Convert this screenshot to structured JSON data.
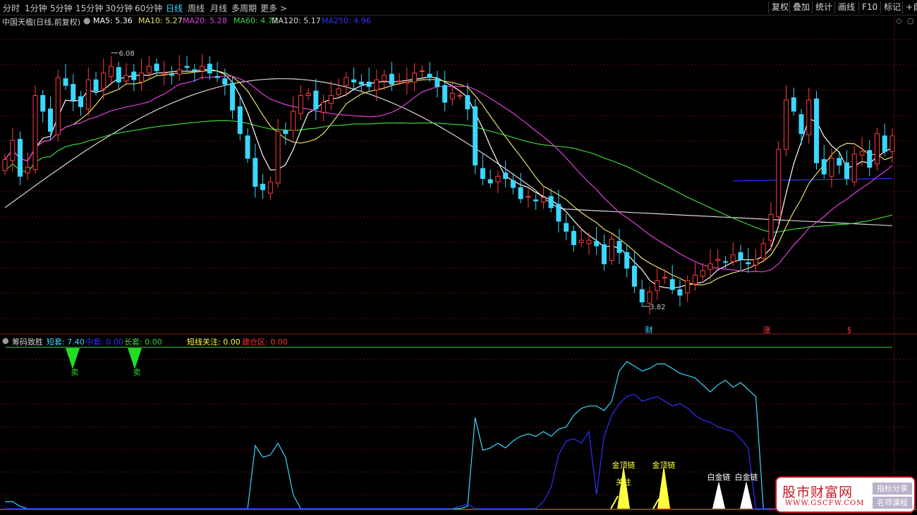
{
  "toolbar": {
    "tabs": [
      "分时",
      "1分钟",
      "5分钟",
      "15分钟",
      "30分钟",
      "60分钟",
      "日线",
      "周线",
      "月线",
      "多周期",
      "更多 >"
    ],
    "active_tab": "日线",
    "right_buttons": [
      "复权",
      "叠加",
      "统计",
      "画线",
      "F10",
      "标记",
      "+自"
    ]
  },
  "main_chart": {
    "title": "中国天楹(日线,前复权)",
    "ma": [
      {
        "label": "MA5: 5.36",
        "color": "#ffffff"
      },
      {
        "label": "MA10: 5.27",
        "color": "#e8e06a"
      },
      {
        "label": "MA20: 5.28",
        "color": "#e040e0"
      },
      {
        "label": "MA60: 4.72",
        "color": "#3fd23f"
      },
      {
        "label": "MA120: 5.17",
        "color": "#d8d8d8"
      },
      {
        "label": "MA250: 4.96",
        "color": "#3030ff"
      }
    ],
    "high_label": "6.08",
    "low_label": "3.82",
    "markers": [
      {
        "text": "财",
        "color": "#3ad7ff"
      },
      {
        "text": "涨",
        "color": "#ff4040"
      },
      {
        "text": "§",
        "color": "#ff4040"
      }
    ]
  },
  "indicator": {
    "name": "筹码致胜",
    "items": [
      {
        "label": "短套: ",
        "value": "7.40",
        "color": "#3ad7ff"
      },
      {
        "label": "中套: ",
        "value": "0.00",
        "color": "#3030ff"
      },
      {
        "label": "长套: ",
        "value": "0.00",
        "color": "#3fd23f"
      },
      {
        "label": "短线关注: ",
        "value": "0.00",
        "color": "#ffff40"
      },
      {
        "label": "建仓区: ",
        "value": "0.00",
        "color": "#ff3030"
      }
    ],
    "signals": [
      {
        "text": "卖",
        "color": "#22dd22"
      },
      {
        "text": "卖",
        "color": "#22dd22"
      },
      {
        "text": "关注",
        "color": "#ffff40"
      },
      {
        "text": "金顶链",
        "color": "#ffff40"
      },
      {
        "text": "金顶链",
        "color": "#ffff40"
      },
      {
        "text": "白金链",
        "color": "#ffffff"
      },
      {
        "text": "白金链",
        "color": "#ffffff"
      }
    ]
  },
  "watermark": {
    "site": "股市财富网",
    "url": "WWW.GSCFW.COM",
    "tag1": "指标分享",
    "tag2": "名师课程"
  },
  "chart_data": {
    "type": "candlestick",
    "y_unit": "price",
    "ylim": [
      3.6,
      6.3
    ],
    "high": 6.08,
    "low": 3.82,
    "closes": [
      5.13,
      5.3,
      4.98,
      5.06,
      5.7,
      5.56,
      5.38,
      5.86,
      5.79,
      5.66,
      5.6,
      5.84,
      5.74,
      5.9,
      5.96,
      5.82,
      5.88,
      5.84,
      5.9,
      5.96,
      5.92,
      5.9,
      5.88,
      5.93,
      5.95,
      5.92,
      5.96,
      5.9,
      5.86,
      5.8,
      5.57,
      5.36,
      5.14,
      4.89,
      4.86,
      4.93,
      5.38,
      5.36,
      5.56,
      5.7,
      5.72,
      5.58,
      5.64,
      5.7,
      5.76,
      5.86,
      5.82,
      5.8,
      5.78,
      5.84,
      5.88,
      5.8,
      5.83,
      5.82,
      5.9,
      5.92,
      5.86,
      5.78,
      5.64,
      5.72,
      5.7,
      5.58,
      5.08,
      4.96,
      4.92,
      4.98,
      4.96,
      4.88,
      4.78,
      4.8,
      4.76,
      4.79,
      4.7,
      4.58,
      4.49,
      4.37,
      4.41,
      4.41,
      4.36,
      4.2,
      4.42,
      4.3,
      4.16,
      4.0,
      3.86,
      3.95,
      4.05,
      4.08,
      3.97,
      3.92,
      4.05,
      4.1,
      4.14,
      4.2,
      4.24,
      4.22,
      4.28,
      4.24,
      4.2,
      4.24,
      4.38,
      4.64,
      5.22,
      5.66,
      5.56,
      5.36,
      5.66,
      5.1,
      5.0,
      5.14,
      5.08,
      4.96,
      5.18,
      5.2,
      5.06,
      5.36,
      5.2,
      5.34
    ],
    "series": [
      {
        "name": "MA5",
        "color": "#ffffff",
        "last": 5.36
      },
      {
        "name": "MA10",
        "color": "#e8e06a",
        "last": 5.27
      },
      {
        "name": "MA20",
        "color": "#e040e0",
        "last": 5.28
      },
      {
        "name": "MA60",
        "color": "#3fd23f",
        "last": 4.72
      },
      {
        "name": "MA120",
        "color": "#d8d8d8",
        "last": 5.17
      },
      {
        "name": "MA250",
        "color": "#3030ff",
        "last": 4.96
      }
    ],
    "indicator_series": [
      {
        "name": "短套",
        "color": "#3ad7ff",
        "values": [
          0.3,
          0.3,
          0.1,
          0,
          0,
          0,
          0,
          0,
          0,
          0,
          0,
          0,
          0,
          0,
          0,
          0,
          0,
          0,
          0,
          0,
          0,
          0,
          0,
          0,
          0,
          0,
          0,
          0,
          0,
          0,
          0,
          0,
          0,
          2.7,
          2.2,
          2.3,
          2.8,
          2.2,
          0.6,
          0,
          0,
          0,
          0,
          0,
          0,
          0,
          0,
          0,
          0,
          0,
          0,
          0,
          0,
          0,
          0,
          0,
          0,
          0,
          0,
          0,
          0,
          0.1,
          3.9,
          2.5,
          2.6,
          2.8,
          2.6,
          2.9,
          3.1,
          3.2,
          3.1,
          3.3,
          3.1,
          3.4,
          3.5,
          4.0,
          4.3,
          4.4,
          4.4,
          4.2,
          4.6,
          5.9,
          6.3,
          6.1,
          5.9,
          6.0,
          6.2,
          6.2,
          6.0,
          5.8,
          5.7,
          5.6,
          5.3,
          5.0,
          5.3,
          5.5,
          5.2,
          5.4,
          5.1,
          4.8,
          0,
          0,
          0,
          0,
          0,
          0,
          0.6,
          1.0,
          0.9,
          1.3,
          0.8,
          1.1,
          0.9,
          0.6
        ]
      },
      {
        "name": "中套",
        "color": "#3030ff",
        "values": [
          0,
          0,
          0,
          0,
          0,
          0,
          0,
          0,
          0,
          0,
          0,
          0,
          0,
          0,
          0,
          0,
          0,
          0,
          0,
          0,
          0,
          0,
          0,
          0,
          0,
          0,
          0,
          0,
          0,
          0,
          0,
          0,
          0,
          0,
          0,
          0,
          0,
          0,
          0,
          0,
          0,
          0,
          0,
          0,
          0,
          0,
          0,
          0,
          0,
          0,
          0,
          0,
          0,
          0,
          0,
          0,
          0,
          0,
          0,
          0,
          0.1,
          0.2,
          0,
          0,
          0,
          0,
          0,
          0,
          0,
          0,
          0,
          0.3,
          0.9,
          2.3,
          2.9,
          3.0,
          2.8,
          3.3,
          0.6,
          3.1,
          4.0,
          4.5,
          4.8,
          4.9,
          4.6,
          4.7,
          4.8,
          4.6,
          4.4,
          4.5,
          4.3,
          4.0,
          3.8,
          3.7,
          3.5,
          3.4,
          3.3,
          3.0,
          2.6,
          0,
          0,
          0,
          0,
          0,
          0,
          0,
          0,
          0,
          0,
          0,
          0,
          0,
          0,
          0,
          0,
          0,
          0,
          0
        ]
      }
    ]
  }
}
